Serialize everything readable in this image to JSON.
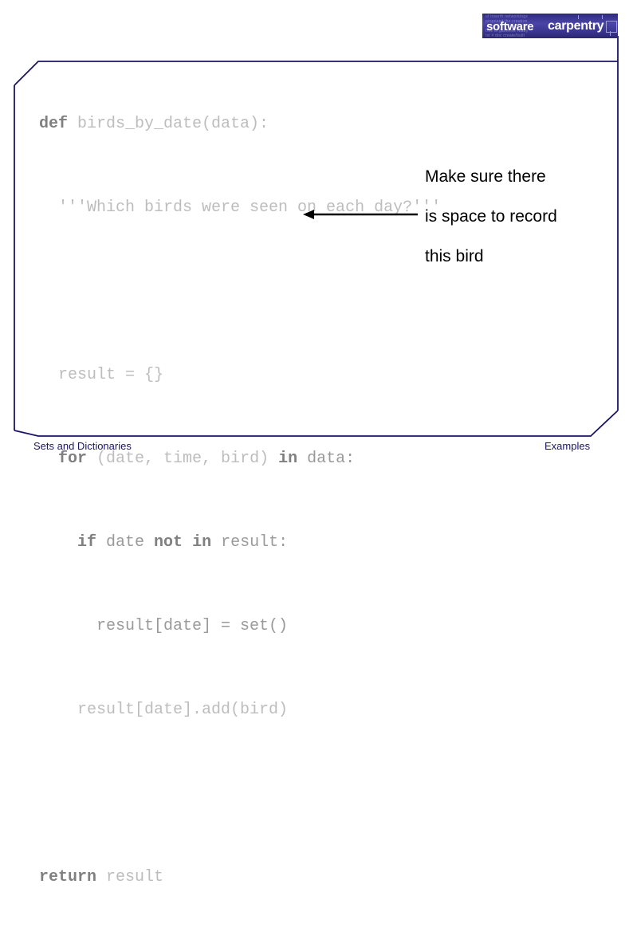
{
  "slide": {
    "logo": {
      "word_1": "software",
      "word_2": "carpentry",
      "faint_line_1": "of  inserth  networkings",
      "faint_line_2": "proposed  the  creation",
      "faint_line_3": "free  in  gatheree  ready",
      "faint_line_4": "txt  #  doc  create/built"
    },
    "code": {
      "line_1_keyword": "def",
      "line_1_rest": " birds_by_date(data):",
      "line_2": "  '''Which birds were seen on each day?'''",
      "line_3": "  result = {}",
      "line_4_indent": "  ",
      "line_4_kw_for": "for",
      "line_4_mid1": " (date, time, bird) ",
      "line_4_kw_in": "in",
      "line_4_mid2": " data:",
      "line_5_indent": "    ",
      "line_5_kw_if": "if",
      "line_5_mid1": " date ",
      "line_5_kw_not": "not",
      "line_5_sp": " ",
      "line_5_kw_in": "in",
      "line_5_mid2": " result:",
      "line_6": "      result[date] = set()",
      "line_7": "    result[date].add(bird)",
      "line_8_kw_return": "return",
      "line_8_rest": " result"
    },
    "annotation": {
      "line_1": "Make sure there",
      "line_2": "is space to record",
      "line_3": "this bird"
    },
    "footer": {
      "left": "Sets and Dictionaries",
      "right": "Examples"
    },
    "colors": {
      "frame": "#1b1464",
      "logo_background": "#3b368f",
      "code_keyword": "#808080",
      "code_body": "#b4b4b4",
      "annotation": "#000000",
      "footer": "#1b1464"
    }
  }
}
